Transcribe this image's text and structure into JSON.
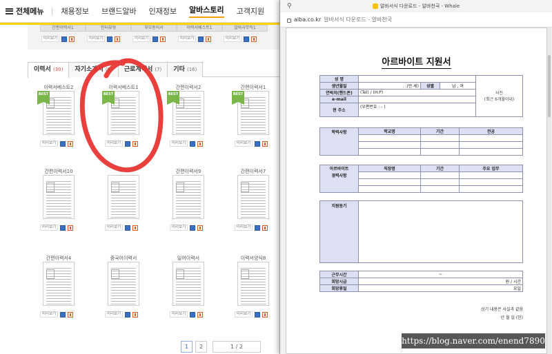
{
  "nav": {
    "menu_label": "전체메뉴",
    "items": [
      "채용정보",
      "브랜드알바",
      "인재정보",
      "알바스토리",
      "고객지원"
    ],
    "active": "알바스토리"
  },
  "upper_row": {
    "items": [
      {
        "label": "간편이력서1"
      },
      {
        "label": "인터뷰형"
      },
      {
        "label": "부모동의서"
      },
      {
        "label": "이력서베스트1"
      },
      {
        "label": "알바사무직1"
      }
    ],
    "view_label": "미리보기"
  },
  "tabs": [
    {
      "label": "이력서",
      "count": "(30)",
      "active": true
    },
    {
      "label": "자기소개서",
      "count": "(9)"
    },
    {
      "label": "근로계약서",
      "count": "(7)"
    },
    {
      "label": "기타",
      "count": "(16)"
    }
  ],
  "cards": [
    {
      "title": "이력서베스트2",
      "best": true
    },
    {
      "title": "이력서베스트1",
      "best": true
    },
    {
      "title": "간편이력서2",
      "best": true
    },
    {
      "title": "간편이력서1",
      "best": true
    },
    {
      "title": "간편이력서10",
      "best": false
    },
    {
      "title": "",
      "best": false
    },
    {
      "title": "간편이력서9",
      "best": false
    },
    {
      "title": "간편이력서7",
      "best": false
    },
    {
      "title": "간편이력서4",
      "best": false
    },
    {
      "title": "중국어이력서",
      "best": false
    },
    {
      "title": "일어이력서",
      "best": false
    },
    {
      "title": "이력서양식8",
      "best": false
    }
  ],
  "card_strings": {
    "best_badge": "BEST",
    "preview": "미리보기"
  },
  "pager": {
    "pages": [
      "1",
      "2"
    ],
    "current": "1",
    "summary": "1 / 2"
  },
  "popup": {
    "window_title": "알바서식 다운로드 - 알바천국 - Whale",
    "url": "alba.co.kr",
    "url_title": "알바서식 다운로드 - 알바천국",
    "doc_title": "아르바이트 지원서",
    "labels": {
      "name": "성 명",
      "birth": "생년월일",
      "age_unit": ". .(만 세)",
      "gender": "성별",
      "gender_options": "남 , 여",
      "phone": "연락처(핸드폰)",
      "phone_value": "(Tel) / (H.P)",
      "email": "e-mail",
      "address": "현 주소",
      "address_value": "(우편번호 : - )",
      "photo": "사진",
      "photo_note": "(최근 6개월이내)",
      "education": "학력사항",
      "school": "학교명",
      "period": "기간",
      "major": "전공",
      "career_1": "아르바이트",
      "career_2": "경력사항",
      "workplace": "직장명",
      "period2": "기간",
      "main_duty": "주요 업무",
      "motivation": "지원동기",
      "work_time": "근무시간",
      "work_time_value": "~",
      "wage": "희망시급",
      "wage_value": "원 / 시간",
      "holiday": "희망휴일",
      "holiday_value": "요일",
      "confirm": "상기 내용은 사실과 같음",
      "date_sign": "년 월 일 (인)"
    }
  },
  "watermark": "https://blog.naver.com/enend7890",
  "colors": {
    "accent": "#ffd200",
    "best": "#7ab648",
    "header_cell": "#dde0f3",
    "mark": "#e8302c"
  }
}
